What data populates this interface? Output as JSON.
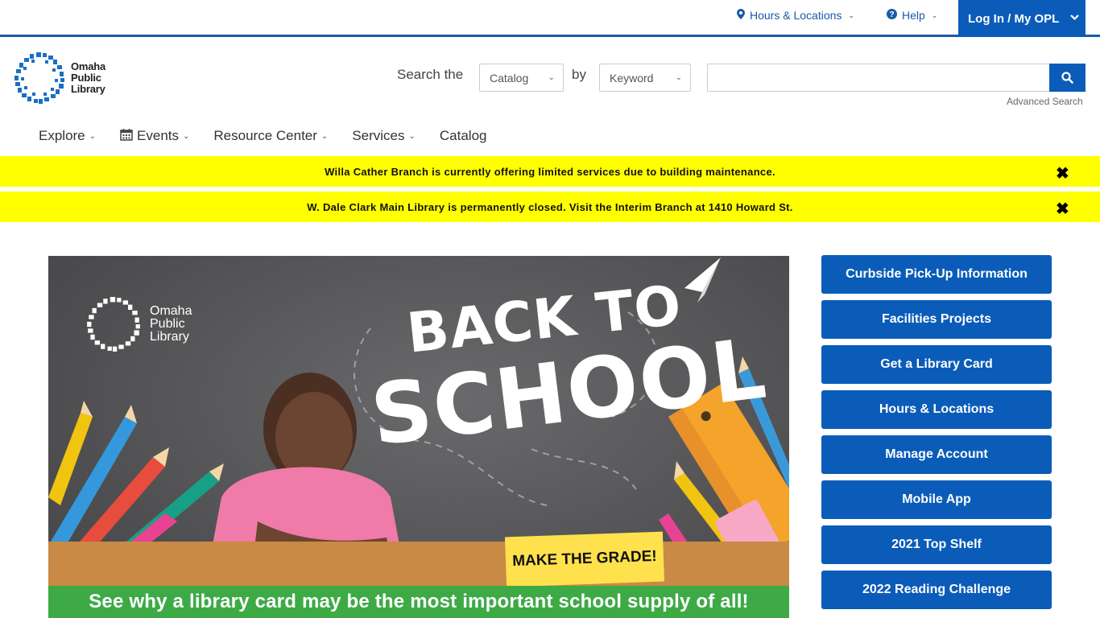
{
  "utility": {
    "hours_label": "Hours & Locations",
    "help_label": "Help",
    "login_label": "Log In / My OPL"
  },
  "logo": {
    "line1": "Omaha",
    "line2": "Public",
    "line3": "Library"
  },
  "search": {
    "prefix": "Search the",
    "scope_value": "Catalog",
    "by_label": "by",
    "field_value": "Keyword",
    "query_value": "",
    "advanced_label": "Advanced Search"
  },
  "nav": {
    "items": [
      {
        "label": "Explore"
      },
      {
        "label": "Events"
      },
      {
        "label": "Resource Center"
      },
      {
        "label": "Services"
      },
      {
        "label": "Catalog"
      }
    ]
  },
  "alerts": [
    {
      "text": "Willa Cather Branch is currently offering limited services due to building maintenance."
    },
    {
      "text": "W. Dale Clark Main Library is permanently closed. Visit the Interim Branch at 1410 Howard St."
    }
  ],
  "hero": {
    "logo_line1": "Omaha",
    "logo_line2": "Public",
    "logo_line3": "Library",
    "title_line1": "BACK TO",
    "title_line2": "SCHOOL",
    "tag": "MAKE THE GRADE!",
    "banner": "See why a library card may be the most important school supply of all!"
  },
  "quick_links": [
    {
      "label": "Curbside Pick-Up Information"
    },
    {
      "label": "Facilities Projects"
    },
    {
      "label": "Get a Library Card"
    },
    {
      "label": "Hours & Locations"
    },
    {
      "label": "Manage Account"
    },
    {
      "label": "Mobile App"
    },
    {
      "label": "2021 Top Shelf"
    },
    {
      "label": "2022 Reading Challenge"
    }
  ],
  "colors": {
    "brand_blue": "#0b5cb8",
    "alert_yellow": "#ffff00",
    "banner_green": "#3daa46"
  }
}
